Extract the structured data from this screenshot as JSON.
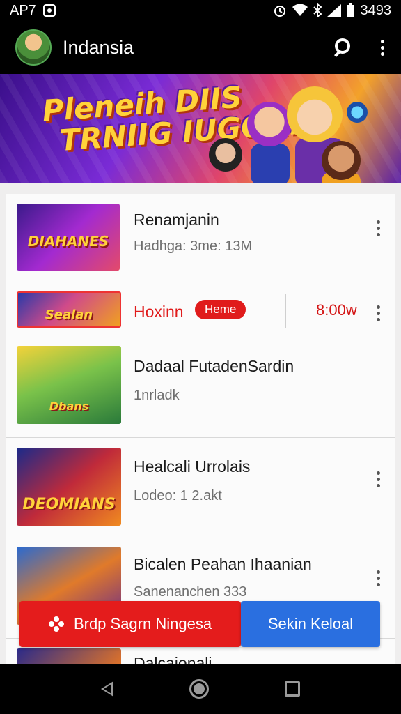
{
  "status_bar": {
    "carrier": "AP7",
    "time": "3493"
  },
  "app_bar": {
    "title": "Indansia"
  },
  "banner": {
    "title_line1": "Pleneih DIIS",
    "title_line2": "TRNIIG IUGOA!!"
  },
  "list": {
    "items": [
      {
        "title": "Renamjanin",
        "subtitle": "Hadhga: 3me: 13M",
        "thumb_label": "DIAHANES"
      },
      {
        "title": "Hoxinn",
        "badge": "Heme",
        "time": "8:00w",
        "thumb_label": "Sealan"
      },
      {
        "title": "Dadaal FutadenSardin",
        "subtitle": "1nrladk",
        "thumb_label": "Dbans"
      },
      {
        "title": "Healcali Urrolais",
        "subtitle": "Lodeo: 1 2.akt",
        "thumb_label": "DEOMIANS"
      },
      {
        "title": "Bicalen Peahan Ihaanian",
        "subtitle": "Sanenanchen 333",
        "thumb_label": ""
      },
      {
        "title": "Dalcaionali",
        "subtitle": "",
        "thumb_label": ""
      }
    ]
  },
  "actions": {
    "primary_label": "Brdp Sagrn Ningesa",
    "secondary_label": "Sekin Keloal"
  },
  "colors": {
    "accent_red": "#e41c1c",
    "accent_blue": "#2a6fe0",
    "time_red": "#d41616"
  },
  "icons": {
    "status": [
      "image-icon",
      "alarm-icon",
      "wifi-icon",
      "bluetooth-icon",
      "signal-icon",
      "battery-icon"
    ],
    "app_bar": [
      "avatar",
      "search-icon",
      "more-vert-icon"
    ],
    "nav": [
      "back-icon",
      "home-icon",
      "recents-icon"
    ]
  }
}
